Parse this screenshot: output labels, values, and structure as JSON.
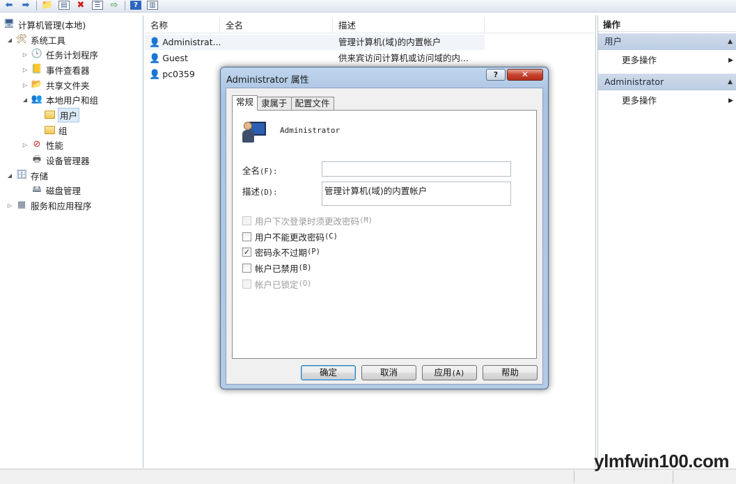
{
  "tree": {
    "root": "计算机管理(本地)",
    "items": [
      {
        "label": "系统工具"
      },
      {
        "label": "任务计划程序"
      },
      {
        "label": "事件查看器"
      },
      {
        "label": "共享文件夹"
      },
      {
        "label": "本地用户和组"
      },
      {
        "label": "用户"
      },
      {
        "label": "组"
      },
      {
        "label": "性能"
      },
      {
        "label": "设备管理器"
      },
      {
        "label": "存储"
      },
      {
        "label": "磁盘管理"
      },
      {
        "label": "服务和应用程序"
      }
    ]
  },
  "list": {
    "columns": [
      "名称",
      "全名",
      "描述"
    ],
    "rows": [
      {
        "name": "Administrat...",
        "fullname": "",
        "desc": "管理计算机(域)的内置帐户"
      },
      {
        "name": "Guest",
        "fullname": "",
        "desc": "供来宾访问计算机或访问域的内..."
      },
      {
        "name": "pc0359",
        "fullname": "",
        "desc": ""
      }
    ]
  },
  "actions": {
    "title": "操作",
    "groups": [
      {
        "label": "用户",
        "link": "更多操作"
      },
      {
        "label": "Administrator",
        "link": "更多操作"
      }
    ]
  },
  "dialog": {
    "title": "Administrator 属性",
    "help_glyph": "?",
    "close_glyph": "✕",
    "tabs": [
      "常规",
      "隶属于",
      "配置文件"
    ],
    "username": "Administrator",
    "fullname_label": "全名",
    "fullname_acc": "(F):",
    "fullname_value": "",
    "desc_label": "描述",
    "desc_acc": "(D):",
    "desc_value": "管理计算机(域)的内置帐户",
    "checks": [
      {
        "label": "用户下次登录时须更改密码",
        "acc": "(M)",
        "checked": false,
        "enabled": false
      },
      {
        "label": "用户不能更改密码",
        "acc": "(C)",
        "checked": false,
        "enabled": true
      },
      {
        "label": "密码永不过期",
        "acc": "(P)",
        "checked": true,
        "enabled": true
      },
      {
        "label": "帐户已禁用",
        "acc": "(B)",
        "checked": false,
        "enabled": true
      },
      {
        "label": "帐户已锁定",
        "acc": "(O)",
        "checked": false,
        "enabled": false
      }
    ],
    "buttons": {
      "ok": "确定",
      "cancel": "取消",
      "apply": "应用",
      "apply_acc": "(A)",
      "help": "帮助"
    },
    "check_glyph": "✓"
  },
  "watermark": "ylmfwin100.com",
  "icons": [
    "back-icon",
    "forward-icon",
    "up-folder-icon",
    "show-hide-tree-icon",
    "delete-icon",
    "properties-icon",
    "export-icon",
    "help-icon",
    "toggle-pane-icon"
  ]
}
